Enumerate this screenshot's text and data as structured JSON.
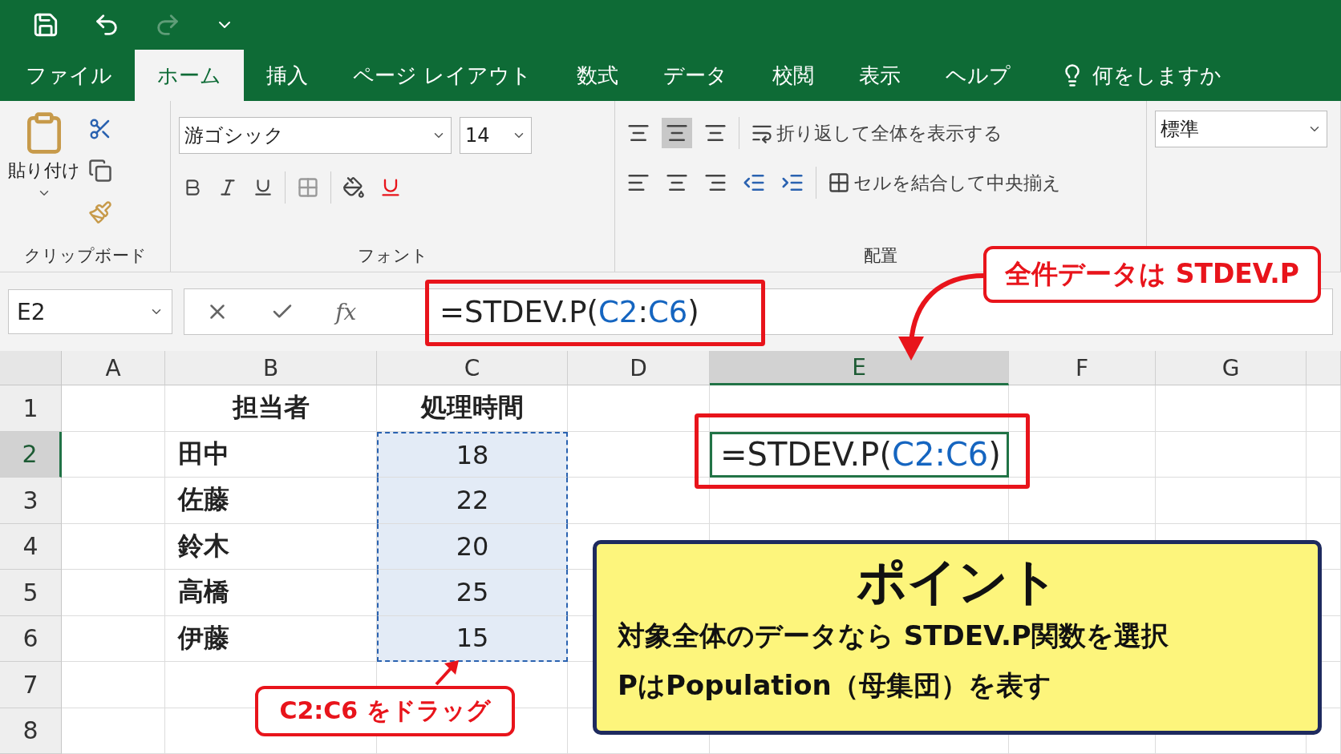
{
  "tabs": [
    {
      "label": "ファイル",
      "selected": false
    },
    {
      "label": "ホーム",
      "selected": true
    },
    {
      "label": "挿入",
      "selected": false
    },
    {
      "label": "ページ レイアウト",
      "selected": false
    },
    {
      "label": "数式",
      "selected": false
    },
    {
      "label": "データ",
      "selected": false
    },
    {
      "label": "校閲",
      "selected": false
    },
    {
      "label": "表示",
      "selected": false
    },
    {
      "label": "ヘルプ",
      "selected": false
    }
  ],
  "tell_me": "何をしますか",
  "ribbon": {
    "clipboard": {
      "paste": "貼り付け",
      "label": "クリップボード"
    },
    "font": {
      "font_name": "游ゴシック",
      "font_size": "14",
      "label": "フォント"
    },
    "alignment": {
      "wrap_text": "折り返して全体を表示する",
      "merge_center": "セルを結合して中央揃え",
      "label": "配置"
    },
    "number": {
      "format": "標準"
    }
  },
  "formula_bar": {
    "name_box": "E2",
    "fx_label": "fx",
    "formula": [
      {
        "text": "=STDEV.P(",
        "kind": "plain"
      },
      {
        "text": "C2",
        "kind": "ref"
      },
      {
        "text": ":",
        "kind": "plain"
      },
      {
        "text": "C6",
        "kind": "ref"
      },
      {
        "text": ")",
        "kind": "plain"
      }
    ]
  },
  "columns": [
    {
      "label": "A",
      "selected": false
    },
    {
      "label": "B",
      "selected": false
    },
    {
      "label": "C",
      "selected": false
    },
    {
      "label": "D",
      "selected": false
    },
    {
      "label": "E",
      "selected": true
    },
    {
      "label": "F",
      "selected": false
    },
    {
      "label": "G",
      "selected": false
    }
  ],
  "rows": [
    {
      "number": "1",
      "selected": false,
      "person": "担当者",
      "time": "処理時間",
      "kind": "header",
      "in_selection": false
    },
    {
      "number": "2",
      "selected": true,
      "person": "田中",
      "time": "18",
      "kind": "data",
      "in_selection": true,
      "e_formula": [
        {
          "text": "=STDEV.P(",
          "kind": "plain"
        },
        {
          "text": "C2:C6",
          "kind": "ref"
        },
        {
          "text": ")",
          "kind": "plain"
        }
      ]
    },
    {
      "number": "3",
      "selected": false,
      "person": "佐藤",
      "time": "22",
      "kind": "data",
      "in_selection": true
    },
    {
      "number": "4",
      "selected": false,
      "person": "鈴木",
      "time": "20",
      "kind": "data",
      "in_selection": true
    },
    {
      "number": "5",
      "selected": false,
      "person": "高橋",
      "time": "25",
      "kind": "data",
      "in_selection": true
    },
    {
      "number": "6",
      "selected": false,
      "person": "伊藤",
      "time": "15",
      "kind": "data",
      "in_selection": true
    },
    {
      "number": "7",
      "selected": false,
      "kind": "data",
      "in_selection": false
    },
    {
      "number": "8",
      "selected": false,
      "kind": "data",
      "in_selection": false
    }
  ],
  "annotations": {
    "top_callout": "全件データは STDEV.P",
    "drag_callout": "C2:C6 をドラッグ",
    "point": {
      "title": "ポイント",
      "lines": [
        "対象全体のデータなら STDEV.P関数を選択",
        "PはPopulation（母集団）を表す"
      ]
    }
  }
}
